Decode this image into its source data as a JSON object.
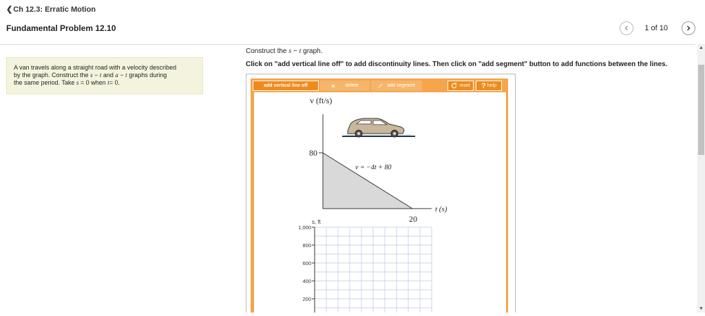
{
  "nav": {
    "back_chevron": "❮",
    "back_label": "Ch 12.3: Erratic Motion",
    "problem_title": "Fundamental Problem 12.10",
    "pager_text": "1 of 10",
    "prev_icon": "chevron-left-icon",
    "next_icon": "chevron-right-icon"
  },
  "problem": {
    "line1": "A van travels along a straight road with a velocity described",
    "line2_a": "by the graph. Construct the ",
    "s": "s",
    "dash": " − ",
    "t": "t",
    "and": " and ",
    "a": "a",
    "line2_b": " graphs during",
    "line3_a": "the same period. Take ",
    "eq0": " = 0 when ",
    "eq1": "= 0."
  },
  "instructions": {
    "construct_a": "Construct the ",
    "construct_b": " graph.",
    "main": "Click on \"add vertical line off\" to add discontinuity lines. Then click on \"add segment\" button to add functions between the lines."
  },
  "toolbar": {
    "add_vertical": "add vertical line off",
    "delete": "delete",
    "add_segment": "add segment",
    "reset": "reset",
    "help": "help",
    "reset_icon": "reset-icon",
    "help_icon": "question-icon"
  },
  "velocity_graph": {
    "ylabel": "v (ft/s)",
    "xlabel": "t (s)",
    "equation": "v = −4t + 80",
    "y_tick": "80",
    "x_tick": "20",
    "v0": 80,
    "t_end": 20,
    "image_icon": "van-icon"
  },
  "s_graph": {
    "ylabel": "s, ft",
    "y_ticks": [
      "1,000",
      "800",
      "600",
      "400",
      "200"
    ]
  },
  "colors": {
    "orange": "#f6a54a",
    "orange_dark": "#f08a1c",
    "problem_bg": "#f4f4de",
    "grid": "#b8c4e8"
  }
}
